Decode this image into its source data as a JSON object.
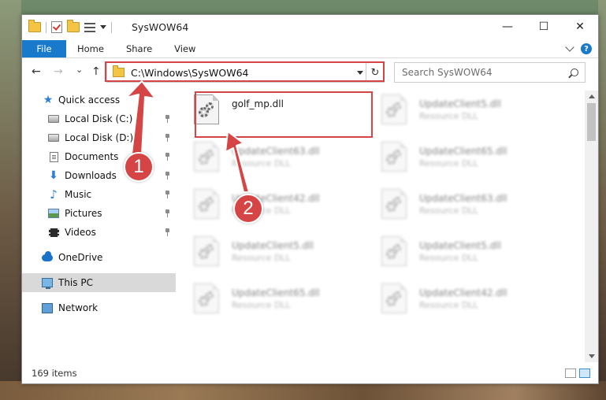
{
  "window": {
    "title": "SysWOW64",
    "controls": {
      "minimize": "—",
      "maximize": "☐",
      "close": "✕"
    }
  },
  "ribbon": {
    "file_tab": "File",
    "tabs": [
      "Home",
      "Share",
      "View"
    ],
    "help": "?"
  },
  "navigation": {
    "back": "←",
    "forward": "→",
    "recent": "⌄",
    "up": "↑",
    "address": "C:\\Windows\\SysWOW64",
    "refresh": "↻",
    "search_placeholder": "Search SysWOW64"
  },
  "sidebar": {
    "items": [
      {
        "label": "Quick access",
        "icon": "quick-access-star-icon",
        "pinned": false
      },
      {
        "label": "Local Disk (C:)",
        "icon": "drive-icon",
        "pinned": true
      },
      {
        "label": "Local Disk (D:)",
        "icon": "drive-icon",
        "pinned": true
      },
      {
        "label": "Documents",
        "icon": "documents-icon",
        "pinned": true
      },
      {
        "label": "Downloads",
        "icon": "downloads-icon",
        "pinned": true
      },
      {
        "label": "Music",
        "icon": "music-icon",
        "pinned": true
      },
      {
        "label": "Pictures",
        "icon": "pictures-icon",
        "pinned": true
      },
      {
        "label": "Videos",
        "icon": "videos-icon",
        "pinned": true
      },
      {
        "label": "OneDrive",
        "icon": "onedrive-icon",
        "pinned": false
      },
      {
        "label": "This PC",
        "icon": "this-pc-icon",
        "pinned": false,
        "selected": true
      },
      {
        "label": "Network",
        "icon": "network-icon",
        "pinned": false
      }
    ]
  },
  "files": {
    "highlighted": {
      "name": "golf_mp.dll",
      "type": ""
    },
    "items": [
      {
        "name": "UpdateClient5.dll",
        "type": "Resource DLL"
      },
      {
        "name": "UpdateClient63.dll",
        "type": "Resource DLL"
      },
      {
        "name": "UpdateClient65.dll",
        "type": "Resource DLL"
      },
      {
        "name": "UpdateClient42.dll",
        "type": "Resource DLL"
      },
      {
        "name": "UpdateClient63.dll",
        "type": "Resource DLL"
      },
      {
        "name": "UpdateClient5.dll",
        "type": "Resource DLL"
      },
      {
        "name": "UpdateClient5.dll",
        "type": "Resource DLL"
      },
      {
        "name": "UpdateClient65.dll",
        "type": "Resource DLL"
      },
      {
        "name": "UpdateClient42.dll",
        "type": "Resource DLL"
      }
    ]
  },
  "status": {
    "item_count": "169 items"
  },
  "annotations": {
    "markers": [
      "1",
      "2"
    ],
    "color": "#d64545"
  },
  "colors": {
    "accent": "#1979ca",
    "selected_bg": "#d9d9d9"
  }
}
